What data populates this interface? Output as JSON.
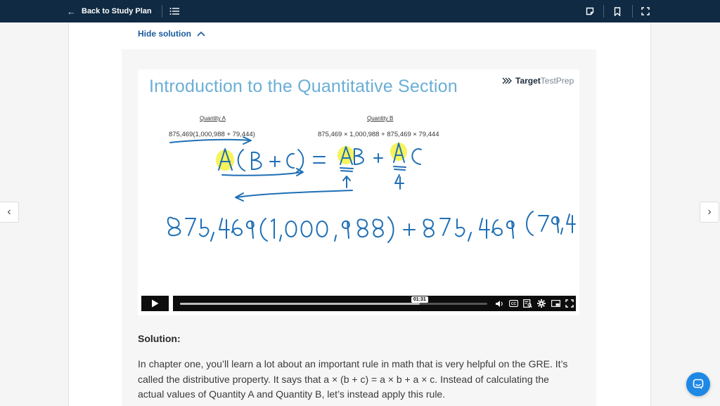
{
  "topbar": {
    "back_label": "Back to Study Plan"
  },
  "solution_toggle": {
    "label": "Hide solution"
  },
  "video": {
    "title": "Introduction to the Quantitative Section",
    "logo": {
      "bold": "Target",
      "light": "TestPrep"
    },
    "quantity_a": {
      "label": "Quantity A",
      "expression": "875,469(1,000,988 + 79,444)"
    },
    "quantity_b": {
      "label": "Quantity B",
      "expression": "875,469 × 1,000,988 + 875,469 × 79,444"
    },
    "current_time": "01:31",
    "progress": 0.78
  },
  "solution": {
    "heading": "Solution:",
    "body": "In chapter one, you’ll learn a lot about an important rule in math that is very helpful on the GRE. It’s called the distributive property. It says that a × (b + c) = a × b + a × c. Instead of calculating the actual values of Quantity A and Quantity B, let’s instead apply this rule."
  },
  "colors": {
    "topbar": "#0f2a42",
    "link": "#1a5a9c",
    "title": "#6aaed6",
    "handwriting": "#1f6fb5",
    "highlight": "#f5f24a",
    "chat": "#1e88e5"
  }
}
